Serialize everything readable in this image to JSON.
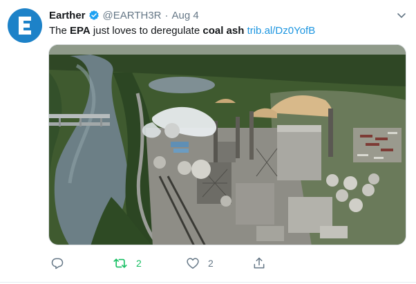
{
  "author": {
    "name": "Earther",
    "handle": "@EARTH3R",
    "separator": "·",
    "time": "Aug 4",
    "verified": true,
    "avatar_icon": "earther-e-logo-icon",
    "avatar_color": "#1d82c8"
  },
  "tweet": {
    "parts": [
      "The ",
      "EPA",
      " just loves to deregulate ",
      "coal ash",
      " "
    ],
    "link": "trib.al/Dz0YofB",
    "link_color": "#1b95e0"
  },
  "media": {
    "icon": "aerial-photo-coal-plant-river"
  },
  "actions": {
    "reply": {
      "icon": "reply-icon",
      "count": ""
    },
    "retweet": {
      "icon": "retweet-icon",
      "count": "2",
      "color": "#17bf63"
    },
    "like": {
      "icon": "heart-icon",
      "count": "2"
    },
    "share": {
      "icon": "share-icon",
      "count": ""
    }
  },
  "menu": {
    "icon": "chevron-down-icon"
  },
  "colors": {
    "secondary_text": "#657786",
    "verified_badge": "#1da1f2"
  }
}
